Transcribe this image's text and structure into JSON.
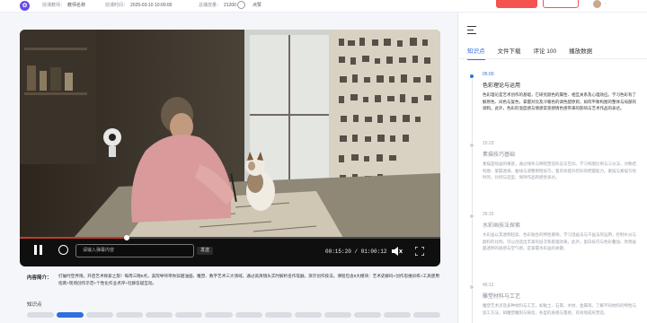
{
  "header": {
    "teacher_key": "授课教师：",
    "teacher_val": "教师名称",
    "time_key": "授课时间：",
    "time_val": "2025-03-10 10:00:00",
    "views_key": "总播放量：",
    "views_val": "21200",
    "like_label": "点赞"
  },
  "player": {
    "danmaku_placeholder": "请输入弹幕内容",
    "send_label": "发送",
    "current_time": "00:15:20",
    "duration": "01:00:12",
    "progress": 0.255
  },
  "intro": {
    "label": "内容简介：",
    "text": "打破时空界限，开启艺术探索之旅！每周三晚8点，美院导师带你穿越油画、雕塑、数字艺术三大领域，通过高清镜头实时解析名作笔触，演示创作技法。课程包含6大模块：艺术史解码+创作思维训练+工具使用指南+现场创作示范+个性化作业点评+社群答疑互动。"
  },
  "knowledge": {
    "label": "知识点",
    "segments": 14,
    "active_index": 1
  },
  "sidebar": {
    "tabs": [
      {
        "label": "知识点",
        "active": true
      },
      {
        "label": "文件下载",
        "active": false
      },
      {
        "label": "评论 100",
        "active": false
      },
      {
        "label": "播放数据",
        "active": false
      }
    ],
    "items": [
      {
        "time": "05:00",
        "title": "色彩理论与运用",
        "active": true,
        "desc": "色彩理论是艺术创作的基础，它研究颜色的属性、相互关系及心理效应。学习色彩有了解原色、间色与复色，掌握对比及冷暖色的调色配原则，如何平衡构图的整体与局部的调和。此外，色彩的温度感与情感常受感情色感带来的影响与艺术作品的表达。"
      },
      {
        "time": "15:23",
        "title": "素描技巧基础",
        "active": false,
        "desc": "素描是绘画的根基，通过线条与明暗塑造形态与空间。学习构图比例与三分法、对象结构图、掌握透视、曲线与调整明暗技巧，着有效提升控形的把握能力。素描与素描写绘时的，比例与造型、保持作品和感觉表达。"
      },
      {
        "time": "26:15",
        "title": "水彩画技法探索",
        "active": false,
        "desc": "水彩画以其透明轻盈、色彩融合的特性著称。学习湿画法与干画法的运用，控制水分与颜料的比例，可以创造出丰富的层次和肌理效果。此外，留白技巧与色彩叠加、改善画面透明的质感与空气感，是掌握水彩画的关键。"
      },
      {
        "time": "45:12",
        "title": "雕塑材料与工艺",
        "active": false,
        "desc": "雕塑艺术涉及多种材料与工艺，如黏土、石膏、木材、金属等。了解不同材料的特性与加工方法，如雕塑雕刻与铸造、各型的质感与量感，有效地成形塑造。"
      }
    ]
  }
}
